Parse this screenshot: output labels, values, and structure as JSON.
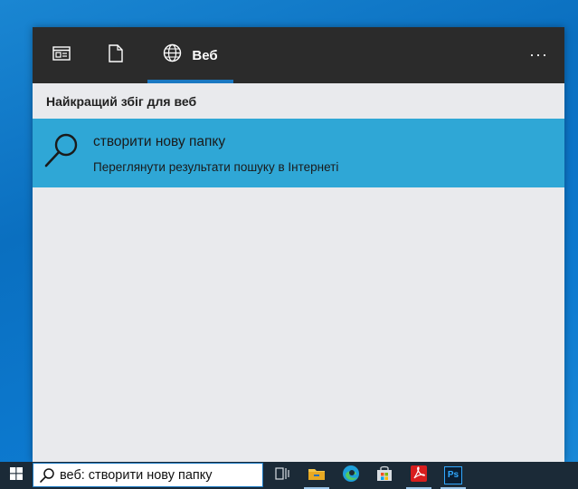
{
  "search_panel": {
    "tabs": [
      {
        "icon": "all-results-icon"
      },
      {
        "icon": "documents-icon"
      },
      {
        "icon": "globe-icon",
        "label": "Веб"
      }
    ],
    "more_label": "···",
    "section_title": "Найкращий збіг для веб",
    "best_match": {
      "icon": "search-icon",
      "title": "створити нову папку",
      "subtitle": "Переглянути результати пошуку в Інтернеті"
    }
  },
  "taskbar": {
    "search_text": "веб: створити нову папку",
    "icons": [
      "windows-start-icon",
      "task-view-icon",
      "file-explorer-icon",
      "edge-icon",
      "store-icon",
      "acrobat-icon",
      "photoshop-icon"
    ],
    "photoshop_label": "Ps"
  },
  "colors": {
    "accent": "#1a78c2",
    "selected_result": "#2fa7d6",
    "panel_header": "#2b2b2b",
    "panel_body": "#e9eaed",
    "taskbar": "#1b2a37"
  }
}
